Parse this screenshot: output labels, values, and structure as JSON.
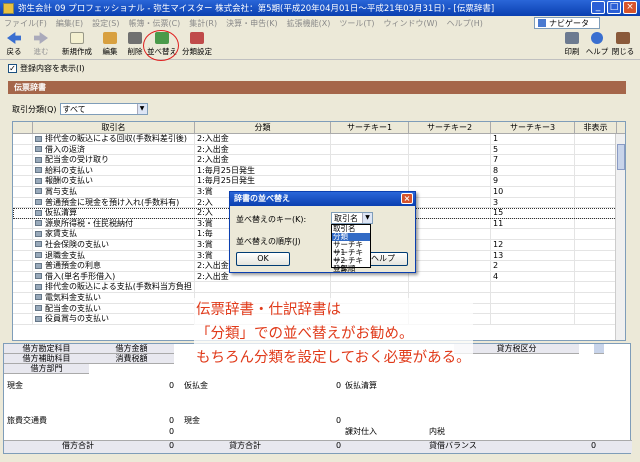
{
  "window": {
    "title": "弥生会計 09 プロフェッショナル - 弥生マイスター 株式会社：第5期(平成20年04月01日～平成21年03月31日) - [伝票辞書]"
  },
  "menu": [
    "ファイル(F)",
    "編集(E)",
    "設定(S)",
    "帳簿・伝票(C)",
    "集計(R)",
    "決算・申告(K)",
    "拡張機能(X)",
    "ツール(T)",
    "ウィンドウ(W)",
    "ヘルプ(H)"
  ],
  "navigator": "ナビゲータ",
  "toolbar": {
    "back": "戻る",
    "forward": "進む",
    "new": "新規作成",
    "edit": "編集",
    "delete": "削除",
    "sort": "並べ替え",
    "class": "分類設定",
    "print": "印刷",
    "help": "ヘルプ",
    "close": "閉じる"
  },
  "show_contents": "登録内容を表示(I)",
  "panel_title": "伝票辞書",
  "filter": {
    "label": "取引分類(Q)",
    "value": "すべて"
  },
  "columns": [
    "取引名",
    "分類",
    "サーチキー1",
    "サーチキー2",
    "サーチキー3",
    "非表示"
  ],
  "rows": [
    {
      "name": "排代金の販込による回収(手数料差引後)",
      "cat": "2:入出金",
      "k3": "1"
    },
    {
      "name": "借入の返済",
      "cat": "2:入出金",
      "k3": "5"
    },
    {
      "name": "配当金の受け取り",
      "cat": "2:入出金",
      "k3": "7"
    },
    {
      "name": "給料の支払い",
      "cat": "1:毎月25日発生",
      "k3": "8"
    },
    {
      "name": "報酬の支払い",
      "cat": "1:毎月25日発生",
      "k3": "9"
    },
    {
      "name": "賞与支払",
      "cat": "3:賞",
      "k3": "10"
    },
    {
      "name": "普通預金に現金を預け入れ(手数料有)",
      "cat": "2:入",
      "k3": "3"
    },
    {
      "name": "仮払清算",
      "cat": "2:入",
      "k3": "15"
    },
    {
      "name": "源泉所得税・住民税納付",
      "cat": "3:賞",
      "k3": "11"
    },
    {
      "name": "家賃支払",
      "cat": "1:毎",
      "k3": ""
    },
    {
      "name": "社会保険の支払い",
      "cat": "3:賞",
      "k3": "12"
    },
    {
      "name": "退職金支払",
      "cat": "3:賞",
      "k3": "13"
    },
    {
      "name": "普通預金の利息",
      "cat": "2:入出金",
      "k3": "2"
    },
    {
      "name": "借入(単名手形借入)",
      "cat": "2:入出金",
      "k3": "4"
    },
    {
      "name": "排代金の販込による支払(手数料当方負担",
      "cat": "",
      "k3": ""
    },
    {
      "name": "電気料金支払い",
      "cat": "",
      "k3": ""
    },
    {
      "name": "配当金の支払い",
      "cat": "",
      "k3": ""
    },
    {
      "name": "役員賞与の支払い",
      "cat": "",
      "k3": ""
    }
  ],
  "detail": {
    "h1": [
      "借方勘定科目",
      "借方金額",
      "",
      "",
      "",
      "貸方税区分"
    ],
    "h2": [
      "借方補助科目",
      "消費税額"
    ],
    "h3": [
      "借方部門"
    ],
    "rows": [
      [
        "現金",
        "0",
        "仮払金",
        "0",
        "仮払清算",
        ""
      ],
      [
        "旅費交通費",
        "0",
        "現金",
        "0",
        "",
        ""
      ],
      [
        "",
        "0",
        "",
        "",
        "課対仕入",
        "内税"
      ]
    ],
    "totals": {
      "debit_label": "借方合計",
      "debit": "0",
      "credit_label": "貸方合計",
      "credit": "0",
      "balance_label": "貸借バランス",
      "balance": "0"
    }
  },
  "dialog": {
    "title": "辞書の並べ替え",
    "key_label": "並べ替えのキー(K):",
    "key_value": "取引名",
    "order_label": "並べ替えの順序(J)",
    "ok": "OK",
    "help": "ヘルプ",
    "options": [
      "取引名",
      "分類",
      "サーチキー1",
      "サーチキー2",
      "サーチキー3",
      "登録順"
    ]
  },
  "note": [
    "伝票辞書・仕訳辞書は",
    "「分類」での並べ替えがお勧め。",
    "もちろん分類を設定しておく必要がある。"
  ]
}
